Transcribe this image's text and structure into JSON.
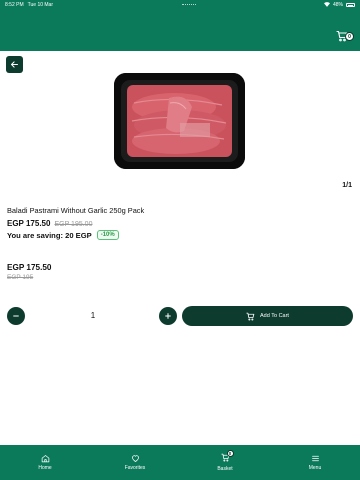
{
  "status_bar": {
    "time": "8:52 PM",
    "date": "Tue 10 Mar",
    "battery": "48%"
  },
  "header": {
    "cart_count": "0"
  },
  "gallery": {
    "counter": "1/1"
  },
  "product": {
    "name": "Baladi Pastrami Without Garlic 250g Pack",
    "price": "EGP 175.50",
    "old_price": "EGP 195.00",
    "saving_text": "You are saving: 20 EGP",
    "discount_badge": "-10%",
    "price_secondary": "EGP 175.50",
    "old_price_secondary": "EGP 195"
  },
  "quantity": {
    "value": "1"
  },
  "actions": {
    "add_to_cart_label": "Add To Cart"
  },
  "bottom_nav": {
    "items": [
      {
        "label": "Home",
        "icon": "home-icon"
      },
      {
        "label": "Favorites",
        "icon": "heart-icon"
      },
      {
        "label": "Basket",
        "icon": "cart-icon",
        "badge": "0"
      },
      {
        "label": "Menu",
        "icon": "menu-icon"
      }
    ]
  },
  "colors": {
    "header": "#0a7a5a",
    "dark_green": "#0d3b2e",
    "discount": "#2e9b4a"
  }
}
